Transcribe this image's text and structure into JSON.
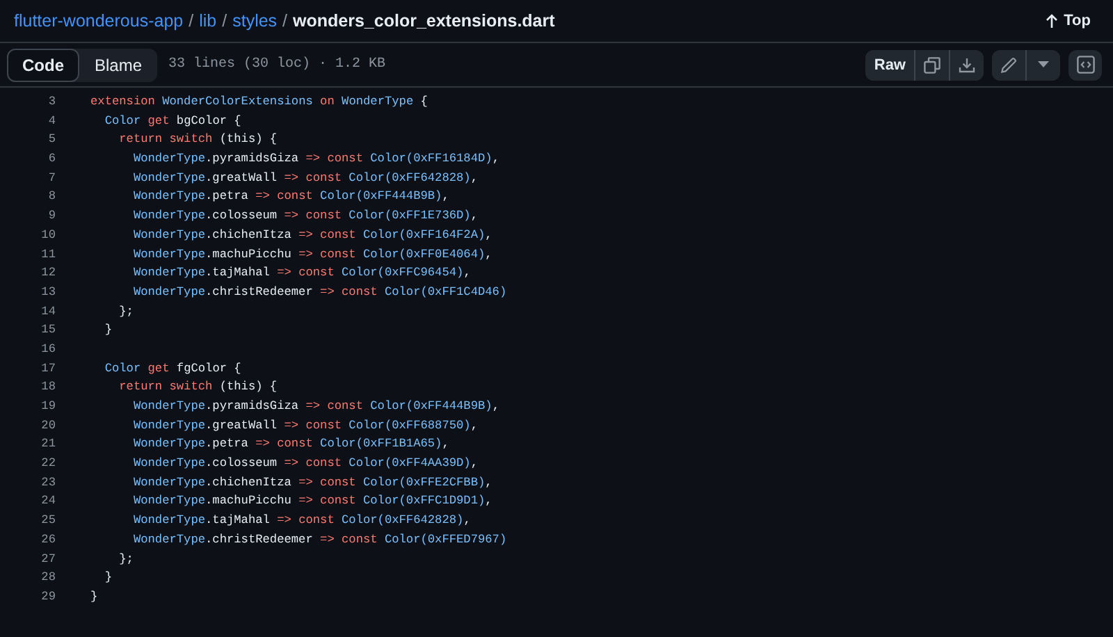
{
  "breadcrumb": [
    {
      "kind": "link",
      "text": "flutter-wonderous-app"
    },
    {
      "kind": "separator",
      "text": "/"
    },
    {
      "kind": "link",
      "text": "lib"
    },
    {
      "kind": "separator",
      "text": "/"
    },
    {
      "kind": "link",
      "text": "styles"
    },
    {
      "kind": "separator",
      "text": "/"
    },
    {
      "kind": "file",
      "text": "wonders_color_extensions.dart"
    }
  ],
  "top_link": "Top",
  "tabs": [
    {
      "label": "Code",
      "selected": true
    },
    {
      "label": "Blame",
      "selected": false
    }
  ],
  "file_info": "33 lines (30 loc) · 1.2 KB",
  "raw_button": "Raw",
  "code_lines": [
    {
      "number": "3",
      "tokens": [
        {
          "kind": "keyword",
          "text": "extension "
        },
        {
          "kind": "type",
          "text": "WonderColorExtensions "
        },
        {
          "kind": "keyword",
          "text": "on "
        },
        {
          "kind": "type",
          "text": "WonderType "
        },
        {
          "kind": "plain",
          "text": "{"
        }
      ]
    },
    {
      "number": "4",
      "tokens": [
        {
          "kind": "type",
          "text": "  Color "
        },
        {
          "kind": "keyword",
          "text": "get "
        },
        {
          "kind": "plain",
          "text": "bgColor {"
        }
      ]
    },
    {
      "number": "5",
      "tokens": [
        {
          "kind": "keyword",
          "text": "    return switch "
        },
        {
          "kind": "plain",
          "text": "(this) {"
        }
      ]
    },
    {
      "number": "6",
      "tokens": [
        {
          "kind": "type",
          "text": "      WonderType"
        },
        {
          "kind": "plain",
          "text": ".pyramidsGiza "
        },
        {
          "kind": "keyword",
          "text": "=> const "
        },
        {
          "kind": "type",
          "text": "Color(0xFF16184D)"
        },
        {
          "kind": "plain",
          "text": ","
        }
      ]
    },
    {
      "number": "7",
      "tokens": [
        {
          "kind": "type",
          "text": "      WonderType"
        },
        {
          "kind": "plain",
          "text": ".greatWall "
        },
        {
          "kind": "keyword",
          "text": "=> const "
        },
        {
          "kind": "type",
          "text": "Color(0xFF642828)"
        },
        {
          "kind": "plain",
          "text": ","
        }
      ]
    },
    {
      "number": "8",
      "tokens": [
        {
          "kind": "type",
          "text": "      WonderType"
        },
        {
          "kind": "plain",
          "text": ".petra "
        },
        {
          "kind": "keyword",
          "text": "=> const "
        },
        {
          "kind": "type",
          "text": "Color(0xFF444B9B)"
        },
        {
          "kind": "plain",
          "text": ","
        }
      ]
    },
    {
      "number": "9",
      "tokens": [
        {
          "kind": "type",
          "text": "      WonderType"
        },
        {
          "kind": "plain",
          "text": ".colosseum "
        },
        {
          "kind": "keyword",
          "text": "=> const "
        },
        {
          "kind": "type",
          "text": "Color(0xFF1E736D)"
        },
        {
          "kind": "plain",
          "text": ","
        }
      ]
    },
    {
      "number": "10",
      "tokens": [
        {
          "kind": "type",
          "text": "      WonderType"
        },
        {
          "kind": "plain",
          "text": ".chichenItza "
        },
        {
          "kind": "keyword",
          "text": "=> const "
        },
        {
          "kind": "type",
          "text": "Color(0xFF164F2A)"
        },
        {
          "kind": "plain",
          "text": ","
        }
      ]
    },
    {
      "number": "11",
      "tokens": [
        {
          "kind": "type",
          "text": "      WonderType"
        },
        {
          "kind": "plain",
          "text": ".machuPicchu "
        },
        {
          "kind": "keyword",
          "text": "=> const "
        },
        {
          "kind": "type",
          "text": "Color(0xFF0E4064)"
        },
        {
          "kind": "plain",
          "text": ","
        }
      ]
    },
    {
      "number": "12",
      "tokens": [
        {
          "kind": "type",
          "text": "      WonderType"
        },
        {
          "kind": "plain",
          "text": ".tajMahal "
        },
        {
          "kind": "keyword",
          "text": "=> const "
        },
        {
          "kind": "type",
          "text": "Color(0xFFC96454)"
        },
        {
          "kind": "plain",
          "text": ","
        }
      ]
    },
    {
      "number": "13",
      "tokens": [
        {
          "kind": "type",
          "text": "      WonderType"
        },
        {
          "kind": "plain",
          "text": ".christRedeemer "
        },
        {
          "kind": "keyword",
          "text": "=> const "
        },
        {
          "kind": "type",
          "text": "Color(0xFF1C4D46)"
        }
      ]
    },
    {
      "number": "14",
      "tokens": [
        {
          "kind": "plain",
          "text": "    };"
        }
      ]
    },
    {
      "number": "15",
      "tokens": [
        {
          "kind": "plain",
          "text": "  }"
        }
      ]
    },
    {
      "number": "16"
    },
    {
      "number": "17",
      "tokens": [
        {
          "kind": "type",
          "text": "  Color "
        },
        {
          "kind": "keyword",
          "text": "get "
        },
        {
          "kind": "plain",
          "text": "fgColor {"
        }
      ]
    },
    {
      "number": "18",
      "tokens": [
        {
          "kind": "keyword",
          "text": "    return switch "
        },
        {
          "kind": "plain",
          "text": "(this) {"
        }
      ]
    },
    {
      "number": "19",
      "tokens": [
        {
          "kind": "type",
          "text": "      WonderType"
        },
        {
          "kind": "plain",
          "text": ".pyramidsGiza "
        },
        {
          "kind": "keyword",
          "text": "=> const "
        },
        {
          "kind": "type",
          "text": "Color(0xFF444B9B)"
        },
        {
          "kind": "plain",
          "text": ","
        }
      ]
    },
    {
      "number": "20",
      "tokens": [
        {
          "kind": "type",
          "text": "      WonderType"
        },
        {
          "kind": "plain",
          "text": ".greatWall "
        },
        {
          "kind": "keyword",
          "text": "=> const "
        },
        {
          "kind": "type",
          "text": "Color(0xFF688750)"
        },
        {
          "kind": "plain",
          "text": ","
        }
      ]
    },
    {
      "number": "21",
      "tokens": [
        {
          "kind": "type",
          "text": "      WonderType"
        },
        {
          "kind": "plain",
          "text": ".petra "
        },
        {
          "kind": "keyword",
          "text": "=> const "
        },
        {
          "kind": "type",
          "text": "Color(0xFF1B1A65)"
        },
        {
          "kind": "plain",
          "text": ","
        }
      ]
    },
    {
      "number": "22",
      "tokens": [
        {
          "kind": "type",
          "text": "      WonderType"
        },
        {
          "kind": "plain",
          "text": ".colosseum "
        },
        {
          "kind": "keyword",
          "text": "=> const "
        },
        {
          "kind": "type",
          "text": "Color(0xFF4AA39D)"
        },
        {
          "kind": "plain",
          "text": ","
        }
      ]
    },
    {
      "number": "23",
      "tokens": [
        {
          "kind": "type",
          "text": "      WonderType"
        },
        {
          "kind": "plain",
          "text": ".chichenItza "
        },
        {
          "kind": "keyword",
          "text": "=> const "
        },
        {
          "kind": "type",
          "text": "Color(0xFFE2CFBB)"
        },
        {
          "kind": "plain",
          "text": ","
        }
      ]
    },
    {
      "number": "24",
      "tokens": [
        {
          "kind": "type",
          "text": "      WonderType"
        },
        {
          "kind": "plain",
          "text": ".machuPicchu "
        },
        {
          "kind": "keyword",
          "text": "=> const "
        },
        {
          "kind": "type",
          "text": "Color(0xFFC1D9D1)"
        },
        {
          "kind": "plain",
          "text": ","
        }
      ]
    },
    {
      "number": "25",
      "tokens": [
        {
          "kind": "type",
          "text": "      WonderType"
        },
        {
          "kind": "plain",
          "text": ".tajMahal "
        },
        {
          "kind": "keyword",
          "text": "=> const "
        },
        {
          "kind": "type",
          "text": "Color(0xFF642828)"
        },
        {
          "kind": "plain",
          "text": ","
        }
      ]
    },
    {
      "number": "26",
      "tokens": [
        {
          "kind": "type",
          "text": "      WonderType"
        },
        {
          "kind": "plain",
          "text": ".christRedeemer "
        },
        {
          "kind": "keyword",
          "text": "=> const "
        },
        {
          "kind": "type",
          "text": "Color(0xFFED7967)"
        }
      ]
    },
    {
      "number": "27",
      "tokens": [
        {
          "kind": "plain",
          "text": "    };"
        }
      ]
    },
    {
      "number": "28",
      "tokens": [
        {
          "kind": "plain",
          "text": "  }"
        }
      ]
    },
    {
      "number": "29",
      "tokens": [
        {
          "kind": "plain",
          "text": "}"
        }
      ]
    }
  ]
}
